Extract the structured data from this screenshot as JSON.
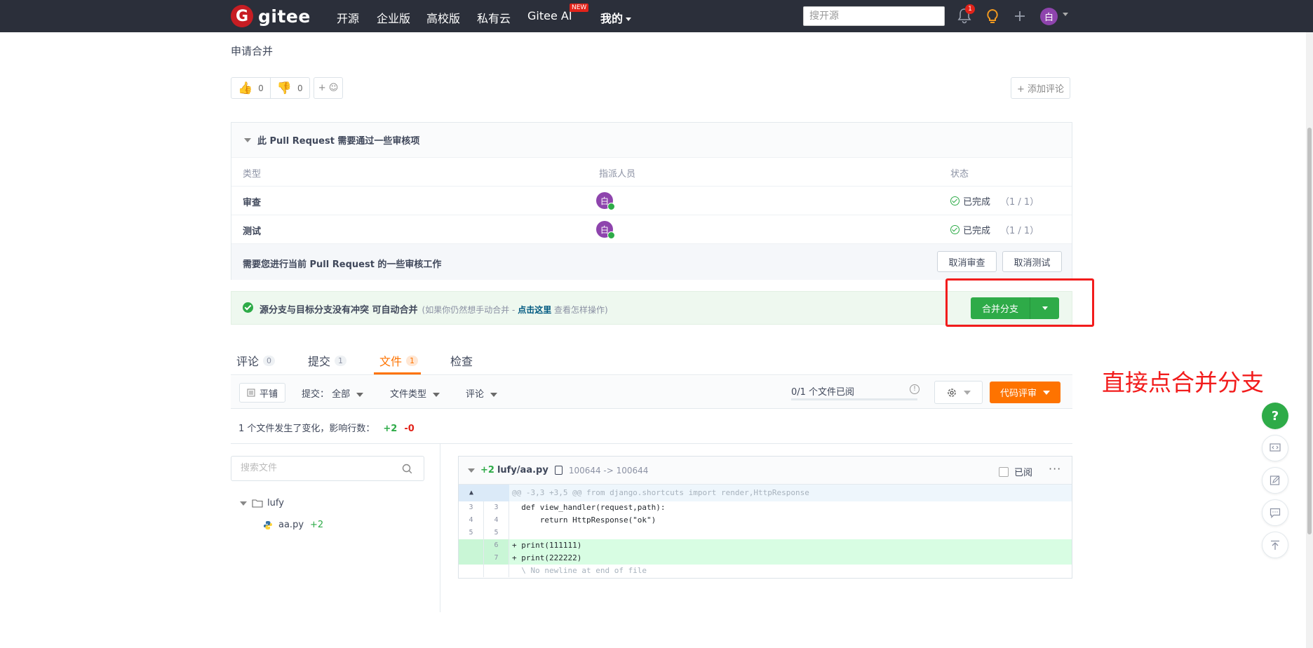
{
  "nav": {
    "logo_text": "gitee",
    "items": [
      "开源",
      "企业版",
      "高校版",
      "私有云",
      "Gitee AI",
      "我的"
    ],
    "new_badge": "NEW",
    "search_placeholder": "搜开源",
    "notification_count": "1",
    "avatar_initial": "白"
  },
  "page": {
    "title": "申请合并",
    "reactions": [
      {
        "icon": "thumbs-up-icon",
        "count": "0"
      },
      {
        "icon": "thumbs-down-icon",
        "count": "0"
      }
    ],
    "add_emoji_label": "+ ☺",
    "add_comment_label": "+ 添加评论"
  },
  "review": {
    "heading": "此 Pull Request 需要通过一些审核项",
    "columns": [
      "类型",
      "指派人员",
      "状态"
    ],
    "rows": [
      {
        "type": "审查",
        "assignee_initial": "白",
        "status": "已完成",
        "count": "（1 / 1）"
      },
      {
        "type": "测试",
        "assignee_initial": "白",
        "status": "已完成",
        "count": "（1 / 1）"
      }
    ],
    "footer_text": "需要您进行当前 Pull Request 的一些审核工作",
    "cancel_review_label": "取消审查",
    "cancel_test_label": "取消测试"
  },
  "merge": {
    "status_text": "源分支与目标分支没有冲突 可自动合并",
    "hint_prefix": "(如果你仍然想手动合并 - ",
    "hint_link": "点击这里",
    "hint_suffix": " 查看怎样操作)",
    "button_label": "合并分支"
  },
  "annotation": "直接点合并分支",
  "tabs": [
    {
      "label": "评论",
      "count": "0"
    },
    {
      "label": "提交",
      "count": "1"
    },
    {
      "label": "文件",
      "count": "1"
    },
    {
      "label": "检查",
      "count": ""
    }
  ],
  "toolbar": {
    "flat_label": "平铺",
    "commit_filter": "提交：  全部",
    "file_type_filter": "文件类型",
    "comment_filter": "评论",
    "progress_text": "0/1 个文件已阅",
    "progress_fraction": 0,
    "code_review_label": "代码评审"
  },
  "summary": {
    "text": "1 个文件发生了变化，影响行数：",
    "added": "+2",
    "removed": "-0"
  },
  "file_tree": {
    "search_placeholder": "搜索文件",
    "folder": "lufy",
    "file": "aa.py",
    "file_added": "+2"
  },
  "diff": {
    "added": "+2",
    "file_path": "lufy/aa.py",
    "mode_change": "100644 -> 100644",
    "viewed_label": "已阅",
    "more_label": "···",
    "hunk_header": "@@ -3,3 +3,5 @@ from django.shortcuts import render,HttpResponse",
    "lines": [
      {
        "old": "3",
        "new": "3",
        "code": "  def view_handler(request,path):"
      },
      {
        "old": "4",
        "new": "4",
        "code": "      return HttpResponse(\"ok\")"
      },
      {
        "old": "5",
        "new": "5",
        "code": ""
      }
    ],
    "added_lines": [
      {
        "new": "6",
        "code": "+ print(111111)"
      },
      {
        "new": "7",
        "code": "+ print(222222)"
      }
    ],
    "no_newline": "  \\ No newline at end of file"
  },
  "side_buttons": [
    "help-icon",
    "code-icon",
    "edit-icon",
    "message-icon",
    "back-to-top-icon"
  ],
  "colors": {
    "nav_bg": "#2b2f3a",
    "brand_red": "#c71d23",
    "success_green": "#2eab48",
    "accent_orange": "#fe7300",
    "annotation_red": "#f21c1c"
  }
}
